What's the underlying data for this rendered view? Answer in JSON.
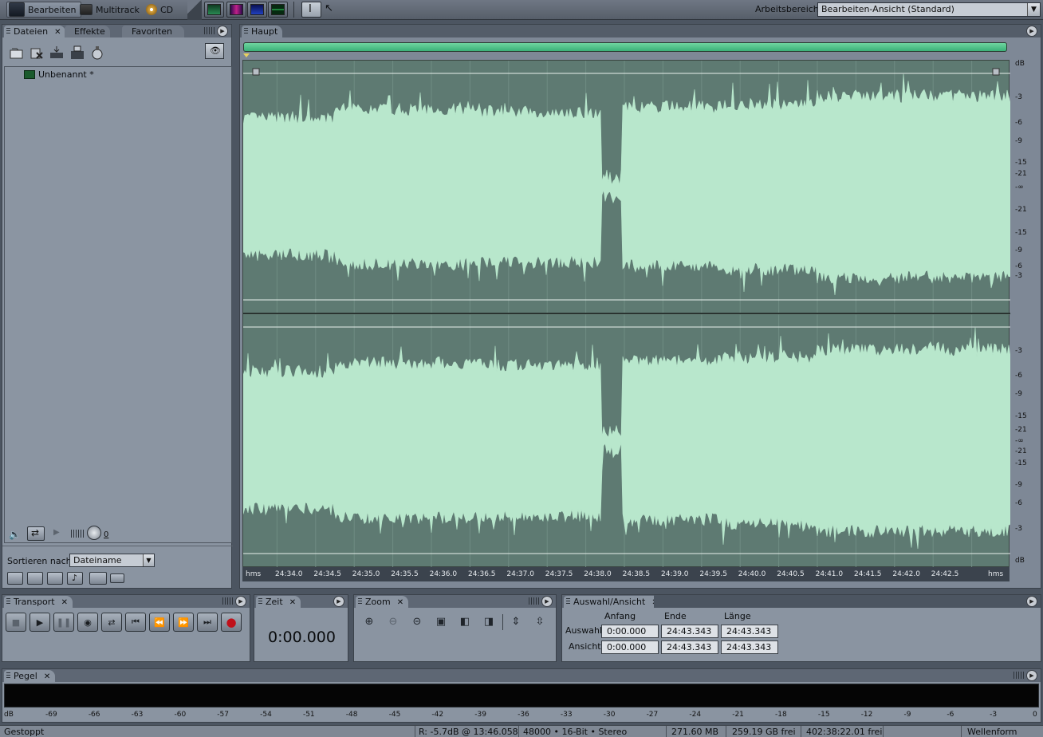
{
  "topbar": {
    "modes": [
      "Bearbeiten",
      "Multitrack",
      "CD"
    ],
    "workspace_label": "Arbeitsbereich:",
    "workspace_value": "Bearbeiten-Ansicht (Standard)"
  },
  "files_panel": {
    "tabs": [
      "Dateien",
      "Effekte",
      "Favoriten"
    ],
    "items": [
      "Unbenannt *"
    ],
    "volume_value": "0",
    "sort_label": "Sortieren nach:",
    "sort_value": "Dateiname"
  },
  "main_panel": {
    "tab": "Haupt",
    "db_unit": "dB",
    "db_ticks_top": [
      "-3",
      "-6",
      "-9",
      "-15",
      "-21",
      "-∞",
      "-21",
      "-15",
      "-9",
      "-6",
      "-3"
    ],
    "db_ticks_bottom": [
      "-3",
      "-6",
      "-9",
      "-15",
      "-21",
      "-∞",
      "-21",
      "-15",
      "-9",
      "-6",
      "-3"
    ],
    "time_unit_left": "hms",
    "time_unit_right": "hms",
    "time_ticks": [
      "24:34.0",
      "24:34.5",
      "24:35.0",
      "24:35.5",
      "24:36.0",
      "24:36.5",
      "24:37.0",
      "24:37.5",
      "24:38.0",
      "24:38.5",
      "24:39.0",
      "24:39.5",
      "24:40.0",
      "24:40.5",
      "24:41.0",
      "24:41.5",
      "24:42.0",
      "24:42.5"
    ]
  },
  "transport_panel": {
    "tab": "Transport"
  },
  "zeit_panel": {
    "tab": "Zeit",
    "value": "0:00.000"
  },
  "zoom_panel": {
    "tab": "Zoom"
  },
  "selection_panel": {
    "tab": "Auswahl/Ansicht",
    "headers": [
      "Anfang",
      "Ende",
      "Länge"
    ],
    "rows": [
      {
        "label": "Auswahl",
        "anfang": "0:00.000",
        "ende": "24:43.343",
        "laenge": "24:43.343"
      },
      {
        "label": "Ansicht",
        "anfang": "0:00.000",
        "ende": "24:43.343",
        "laenge": "24:43.343"
      }
    ]
  },
  "pegel_panel": {
    "tab": "Pegel",
    "scale": [
      "dB",
      "-69",
      "-66",
      "-63",
      "-60",
      "-57",
      "-54",
      "-51",
      "-48",
      "-45",
      "-42",
      "-39",
      "-36",
      "-33",
      "-30",
      "-27",
      "-24",
      "-21",
      "-18",
      "-15",
      "-12",
      "-9",
      "-6",
      "-3",
      "0"
    ]
  },
  "statusbar": {
    "state": "Gestoppt",
    "level": "R: -5.7dB @  13:46.058",
    "format": "48000 • 16-Bit • Stereo",
    "size": "271.60 MB",
    "free": "259.19 GB frei",
    "time_free": "402:38:22.01 frei",
    "view": "Wellenform"
  },
  "colors": {
    "waveform_fill": "#b8e7cc",
    "waveform_bg": "#5e7a72",
    "progress": "#4cc38a",
    "record": "#c0101a"
  }
}
